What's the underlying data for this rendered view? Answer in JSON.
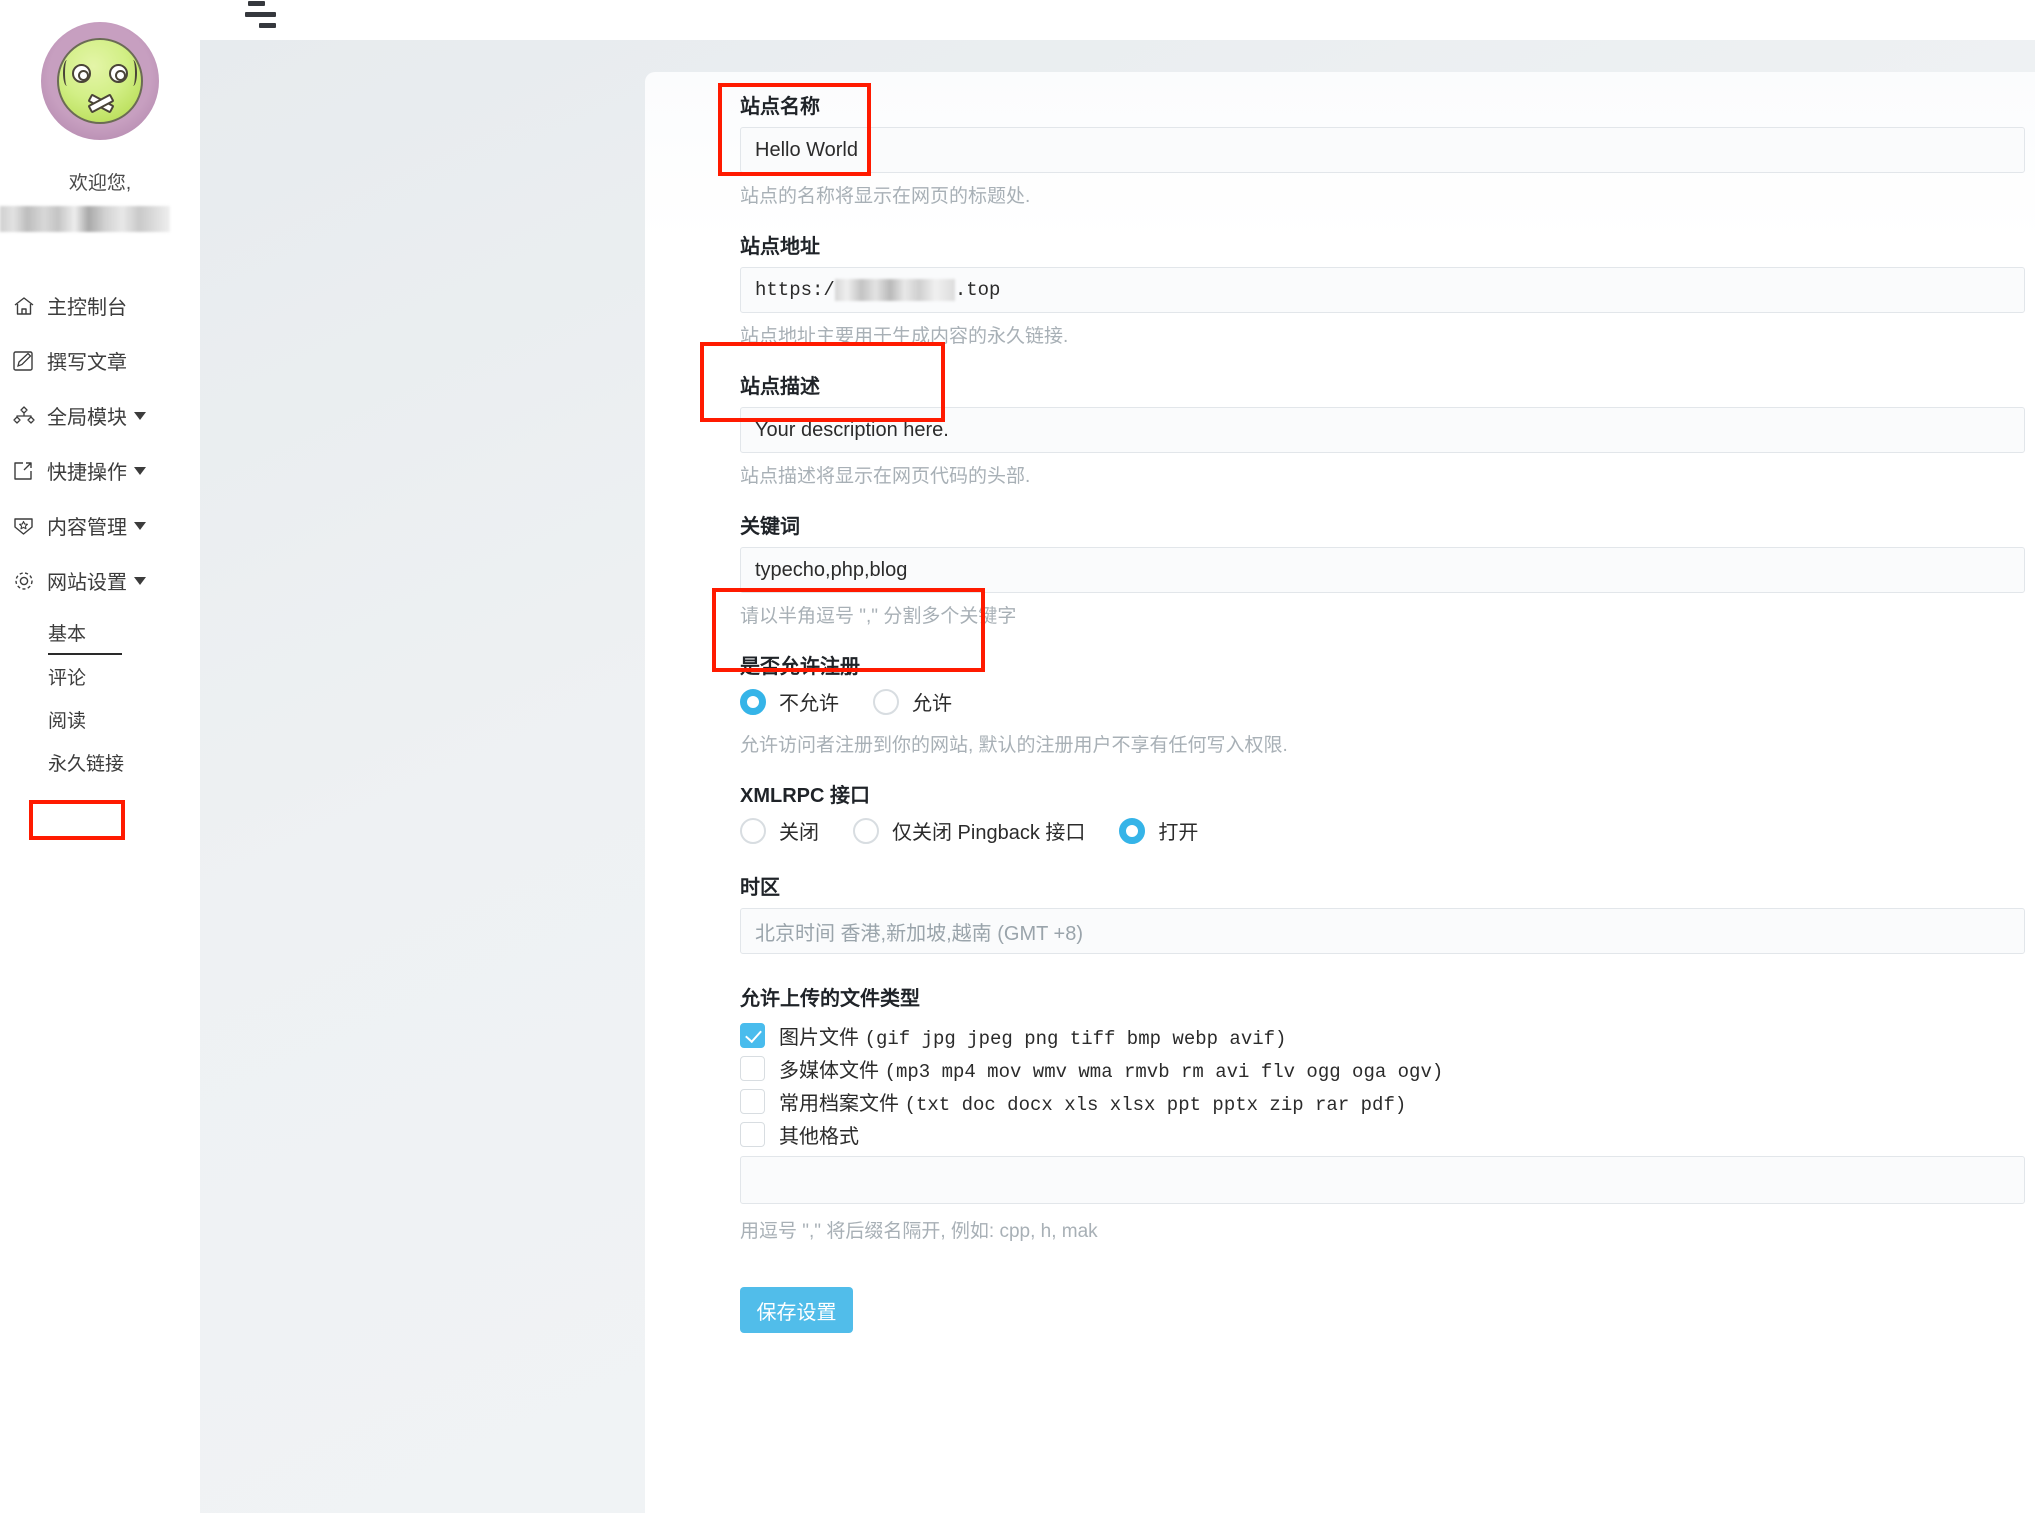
{
  "sidebar": {
    "avatar_name": "dizzy-face-avatar",
    "welcome_text": "欢迎您,",
    "username_redacted": "",
    "items": [
      {
        "label": "主控制台",
        "icon": "home-icon",
        "has_caret": false
      },
      {
        "label": "撰写文章",
        "icon": "pencil-square-icon",
        "has_caret": false
      },
      {
        "label": "全局模块",
        "icon": "sitemap-icon",
        "has_caret": true
      },
      {
        "label": "快捷操作",
        "icon": "external-link-icon",
        "has_caret": true
      },
      {
        "label": "内容管理",
        "icon": "shield-star-icon",
        "has_caret": true
      },
      {
        "label": "网站设置",
        "icon": "gear-icon",
        "has_caret": true
      }
    ],
    "subitems": [
      {
        "label": "基本",
        "active": true
      },
      {
        "label": "评论",
        "active": false
      },
      {
        "label": "阅读",
        "active": false
      },
      {
        "label": "永久链接",
        "active": false
      }
    ]
  },
  "topbar": {
    "menu_icon": "hamburger-icon"
  },
  "form": {
    "site_name": {
      "label": "站点名称",
      "value": "Hello World",
      "hint": "站点的名称将显示在网页的标题处."
    },
    "site_url": {
      "label": "站点地址",
      "value_prefix": "https:/",
      "value_suffix": ".top",
      "hint": "站点地址主要用于生成内容的永久链接."
    },
    "site_description": {
      "label": "站点描述",
      "value": "Your description here.",
      "hint": "站点描述将显示在网页代码的头部."
    },
    "keywords": {
      "label": "关键词",
      "value": "typecho,php,blog",
      "hint": "请以半角逗号 \",\" 分割多个关键字"
    },
    "allow_register": {
      "label": "是否允许注册",
      "options": [
        {
          "label": "不允许",
          "selected": true
        },
        {
          "label": "允许",
          "selected": false
        }
      ],
      "hint": "允许访问者注册到你的网站, 默认的注册用户不享有任何写入权限."
    },
    "xmlrpc": {
      "label": "XMLRPC 接口",
      "options": [
        {
          "label": "关闭",
          "selected": false
        },
        {
          "label": "仅关闭 Pingback 接口",
          "selected": false
        },
        {
          "label": "打开",
          "selected": true
        }
      ]
    },
    "timezone": {
      "label": "时区",
      "value": "北京时间 香港,新加坡,越南 (GMT +8)"
    },
    "upload_types": {
      "label": "允许上传的文件类型",
      "items": [
        {
          "name": "图片文件",
          "exts": "(gif jpg jpeg png tiff bmp webp avif)",
          "checked": true
        },
        {
          "name": "多媒体文件",
          "exts": "(mp3 mp4 mov wmv wma rmvb rm avi flv ogg oga ogv)",
          "checked": false
        },
        {
          "name": "常用档案文件",
          "exts": "(txt doc docx xls xlsx ppt pptx zip rar pdf)",
          "checked": false
        },
        {
          "name": "其他格式",
          "exts": "",
          "checked": false
        }
      ],
      "other_value": "",
      "hint": "用逗号 \",\" 将后缀名隔开, 例如: cpp, h, mak"
    },
    "save_button": "保存设置"
  },
  "annotations": {
    "color": "#ff1a00",
    "boxes": [
      "站点名称",
      "站点描述",
      "是否允许注册",
      "基本"
    ]
  },
  "colors": {
    "accent_blue": "#51bdea",
    "radio_blue": "#35b4e8",
    "checkbox_blue": "#49bced",
    "highlight_red": "#ff1a00",
    "canvas_bg": "#eef1f3"
  }
}
